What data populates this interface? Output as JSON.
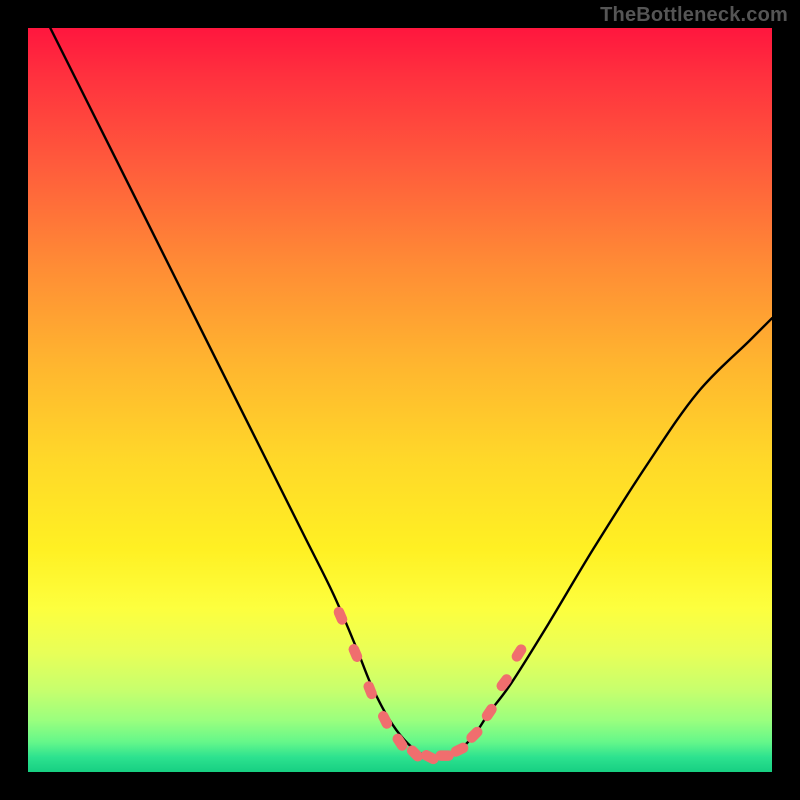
{
  "watermark": "TheBottleneck.com",
  "colors": {
    "background": "#000000",
    "curve_stroke": "#000000",
    "marker_fill": "#f06e6e"
  },
  "chart_data": {
    "type": "line",
    "title": "",
    "xlabel": "",
    "ylabel": "",
    "xlim": [
      0,
      100
    ],
    "ylim": [
      0,
      100
    ],
    "grid": false,
    "note": "No axes; only the curve and highlighted points are rendered over the gradient.",
    "series": [
      {
        "name": "bottleneck-curve",
        "x": [
          3,
          8,
          14,
          20,
          26,
          32,
          37,
          41,
          44,
          46,
          48,
          50,
          52,
          54,
          56,
          58,
          60,
          62,
          65,
          70,
          76,
          83,
          90,
          97,
          100
        ],
        "y": [
          100,
          90,
          78,
          66,
          54,
          42,
          32,
          24,
          17,
          12,
          8,
          5,
          3,
          2,
          2,
          3,
          5,
          8,
          12,
          20,
          30,
          41,
          51,
          58,
          61
        ]
      }
    ],
    "highlighted_points": {
      "name": "marker-cluster",
      "x": [
        42,
        44,
        46,
        48,
        50,
        52,
        54,
        56,
        58,
        60,
        62,
        64,
        66
      ],
      "y": [
        21,
        16,
        11,
        7,
        4,
        2.5,
        2,
        2.2,
        3,
        5,
        8,
        12,
        16
      ]
    }
  }
}
